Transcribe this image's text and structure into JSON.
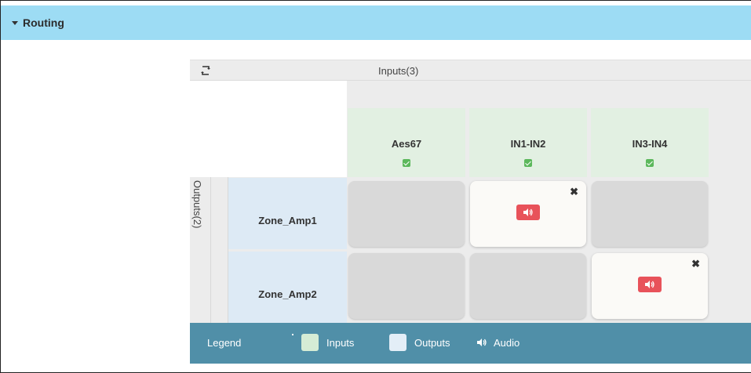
{
  "header": {
    "title": "Routing"
  },
  "matrix": {
    "inputs_title": "Inputs(3)",
    "outputs_title": "Outputs(2)",
    "inputs": [
      "Aes67",
      "IN1-IN2",
      "IN3-IN4"
    ],
    "outputs": [
      "Zone_Amp1",
      "Zone_Amp2"
    ],
    "routes": [
      {
        "output": "Zone_Amp1",
        "input": "IN1-IN2",
        "type": "Audio"
      },
      {
        "output": "Zone_Amp2",
        "input": "IN3-IN4",
        "type": "Audio"
      }
    ]
  },
  "legend": {
    "title": "Legend",
    "inputs_label": "Inputs",
    "outputs_label": "Outputs",
    "audio_label": "Audio"
  },
  "colors": {
    "header_bg": "#9ddcf4",
    "input_header": "#e2f0e2",
    "output_header": "#ddeaf5",
    "legend_bg": "#508fa8",
    "audio_badge": "#e8525a",
    "empty_cell": "#d9d9d9",
    "active_cell": "#fbfaf7",
    "check_green": "#5cb85c"
  },
  "icons": [
    "caret-down-icon",
    "refresh-icon",
    "check-icon",
    "close-icon",
    "audio-icon"
  ]
}
